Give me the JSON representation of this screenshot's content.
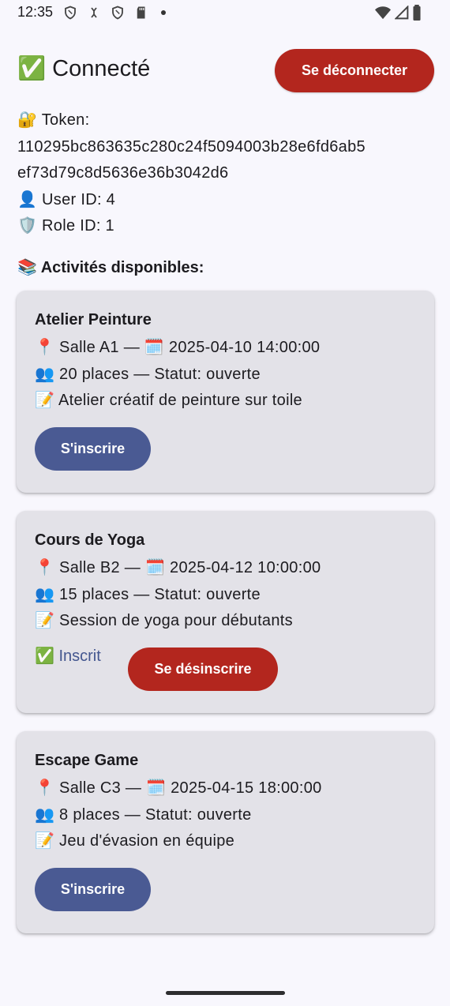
{
  "status_bar": {
    "time": "12:35"
  },
  "header": {
    "title": "✅ Connecté",
    "logout_label": "Se déconnecter"
  },
  "user_info": {
    "token_label": "🔐 Token:",
    "token_line1": "110295bc863635c280c24f5094003b28e6fd6ab5",
    "token_line2": "ef73d79c8d5636e36b3042d6",
    "user_id": "👤 User ID: 4",
    "role_id": "🛡️ Role ID: 1"
  },
  "section_title": "📚 Activités disponibles:",
  "activities": [
    {
      "title": "Atelier Peinture",
      "location": "📍 Salle A1 — 🗓️ 2025-04-10 14:00:00",
      "places": "👥 20 places — Statut: ouverte",
      "description": "📝 Atelier créatif de peinture sur toile",
      "action_label": "S'inscrire"
    },
    {
      "title": "Cours de Yoga",
      "location": "📍 Salle B2 — 🗓️ 2025-04-12 10:00:00",
      "places": "👥 15 places — Statut: ouverte",
      "description": "📝 Session de yoga pour débutants",
      "status_icon": "✅",
      "status_text": "Inscrit",
      "action_label": "Se désinscrire"
    },
    {
      "title": "Escape Game",
      "location": "📍 Salle C3 — 🗓️ 2025-04-15 18:00:00",
      "places": "👥 8 places — Statut: ouverte",
      "description": "📝 Jeu d'évasion en équipe",
      "action_label": "S'inscrire"
    }
  ],
  "colors": {
    "background": "#f8f7fd",
    "card": "#e3e2e8",
    "primary": "#4a5a93",
    "danger": "#b3261e",
    "inscrit_text": "#43568f"
  }
}
